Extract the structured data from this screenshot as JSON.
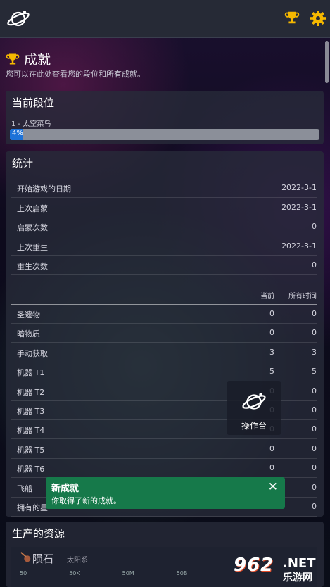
{
  "header": {},
  "page": {
    "title": "成就",
    "subtitle": "您可以在此处查看您的段位和所有成就。"
  },
  "rank_panel": {
    "title": "当前段位",
    "rank_label": "1 - 太空菜鸟",
    "progress_text": "4%",
    "progress_fraction": 0.04
  },
  "stats_panel": {
    "title": "统计",
    "general": [
      {
        "label": "开始游戏的日期",
        "value": "2022-3-1"
      },
      {
        "label": "上次启蒙",
        "value": "2022-3-1"
      },
      {
        "label": "启蒙次数",
        "value": "0"
      },
      {
        "label": "上次重生",
        "value": "2022-3-1"
      },
      {
        "label": "重生次数",
        "value": "0"
      }
    ],
    "columns": {
      "current": "当前",
      "all_time": "所有时间"
    },
    "items": [
      {
        "label": "圣遗物",
        "current": "0",
        "all": "0"
      },
      {
        "label": "暗物质",
        "current": "0",
        "all": "0"
      },
      {
        "label": "手动获取",
        "current": "3",
        "all": "3"
      },
      {
        "label": "机器 T1",
        "current": "5",
        "all": "5"
      },
      {
        "label": "机器 T2",
        "current": "0",
        "all": "0"
      },
      {
        "label": "机器 T3",
        "current": "0",
        "all": "0"
      },
      {
        "label": "机器 T4",
        "current": "0",
        "all": "0"
      },
      {
        "label": "机器 T5",
        "current": "0",
        "all": "0"
      },
      {
        "label": "机器 T6",
        "current": "0",
        "all": "0"
      },
      {
        "label": "飞船",
        "current": "0",
        "all": "0"
      },
      {
        "label": "拥有的星",
        "current": "0",
        "all": "0"
      }
    ]
  },
  "resources_panel": {
    "title": "生产的资源",
    "first_resource": "陨石",
    "first_tag": "太阳系",
    "ticks": [
      "50",
      "50K",
      "50M",
      "50B"
    ]
  },
  "console_button": {
    "label": "操作台"
  },
  "notification": {
    "title": "新成就",
    "message": "你取得了新的成就。",
    "close": "✕"
  },
  "watermark": {
    "number": "962",
    "domain": ".NET",
    "cn": "乐游网"
  },
  "colors": {
    "topbar": "#262a36",
    "accent_gold": "#f5b800",
    "progress": "#1d72d8",
    "notification": "#16794a"
  }
}
